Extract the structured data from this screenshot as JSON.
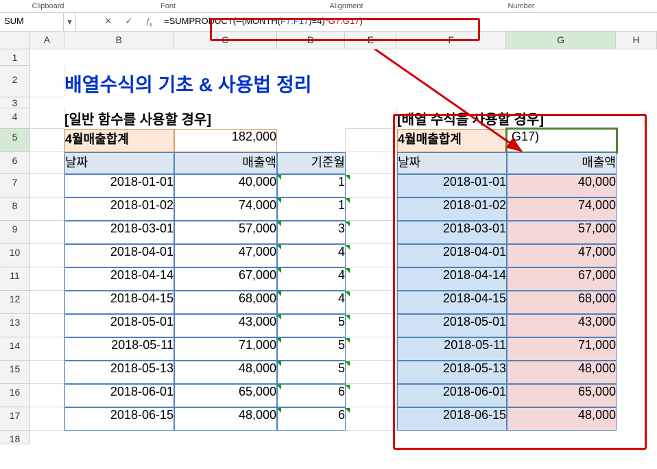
{
  "ribbon": {
    "clipboard": "Clipboard",
    "font": "Font",
    "alignment": "Alignment",
    "number": "Number"
  },
  "namebox": "SUM",
  "formula": {
    "p1": "=SUMPRODUCT(--(MONTH(",
    "r1": "F7:F17",
    "p2": ")=4)*",
    "r2": "G7:G17",
    "p3": ")"
  },
  "cols": {
    "A": "A",
    "B": "B",
    "C": "C",
    "D": "D",
    "E": "E",
    "F": "F",
    "G": "G",
    "H": "H"
  },
  "rows": [
    "1",
    "2",
    "3",
    "4",
    "5",
    "6",
    "7",
    "8",
    "9",
    "10",
    "11",
    "12",
    "13",
    "14",
    "15",
    "16",
    "17",
    "18"
  ],
  "title": "배열수식의 기초 & 사용법 정리",
  "left": {
    "hdr": "[일반 함수를 사용할 경우]",
    "sum_label": "4월매출합계",
    "sum_value": "182,000",
    "h_date": "날짜",
    "h_amt": "매출액",
    "h_month": "기준월"
  },
  "right": {
    "hdr": "[배열 수식을 사용할 경우]",
    "sum_label": "4월매출합계",
    "g5": "G17)",
    "h_date": "날짜",
    "h_amt": "매출액"
  },
  "rows_data": [
    {
      "date": "2018-01-01",
      "amt": "40,000",
      "mon": "1"
    },
    {
      "date": "2018-01-02",
      "amt": "74,000",
      "mon": "1"
    },
    {
      "date": "2018-03-01",
      "amt": "57,000",
      "mon": "3"
    },
    {
      "date": "2018-04-01",
      "amt": "47,000",
      "mon": "4"
    },
    {
      "date": "2018-04-14",
      "amt": "67,000",
      "mon": "4"
    },
    {
      "date": "2018-04-15",
      "amt": "68,000",
      "mon": "4"
    },
    {
      "date": "2018-05-01",
      "amt": "43,000",
      "mon": "5"
    },
    {
      "date": "2018-05-11",
      "amt": "71,000",
      "mon": "5"
    },
    {
      "date": "2018-05-13",
      "amt": "48,000",
      "mon": "5"
    },
    {
      "date": "2018-06-01",
      "amt": "65,000",
      "mon": "6"
    },
    {
      "date": "2018-06-15",
      "amt": "48,000",
      "mon": "6"
    }
  ],
  "chart_data": {
    "type": "table",
    "title": "배열수식의 기초 & 사용법 정리",
    "left_table": {
      "columns": [
        "날짜",
        "매출액",
        "기준월"
      ],
      "rows": [
        [
          "2018-01-01",
          40000,
          1
        ],
        [
          "2018-01-02",
          74000,
          1
        ],
        [
          "2018-03-01",
          57000,
          3
        ],
        [
          "2018-04-01",
          47000,
          4
        ],
        [
          "2018-04-14",
          67000,
          4
        ],
        [
          "2018-04-15",
          68000,
          4
        ],
        [
          "2018-05-01",
          43000,
          5
        ],
        [
          "2018-05-11",
          71000,
          5
        ],
        [
          "2018-05-13",
          48000,
          5
        ],
        [
          "2018-06-01",
          65000,
          6
        ],
        [
          "2018-06-15",
          48000,
          6
        ]
      ],
      "summary": {
        "label": "4월매출합계",
        "value": 182000
      }
    },
    "right_table": {
      "columns": [
        "날짜",
        "매출액"
      ],
      "rows": [
        [
          "2018-01-01",
          40000
        ],
        [
          "2018-01-02",
          74000
        ],
        [
          "2018-03-01",
          57000
        ],
        [
          "2018-04-01",
          47000
        ],
        [
          "2018-04-14",
          67000
        ],
        [
          "2018-04-15",
          68000
        ],
        [
          "2018-05-01",
          43000
        ],
        [
          "2018-05-11",
          71000
        ],
        [
          "2018-05-13",
          48000
        ],
        [
          "2018-06-01",
          65000
        ],
        [
          "2018-06-15",
          48000
        ]
      ],
      "formula": "=SUMPRODUCT(--(MONTH(F7:F17)=4)*G7:G17)"
    }
  }
}
